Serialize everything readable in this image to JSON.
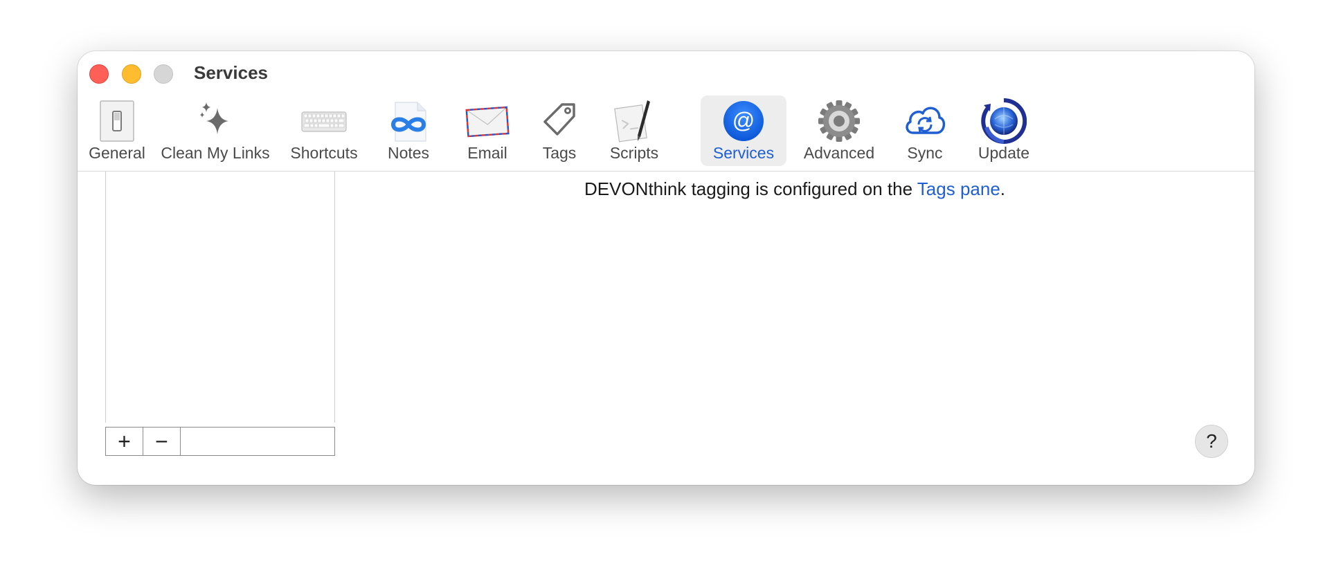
{
  "window": {
    "title": "Services"
  },
  "toolbar": {
    "items": [
      {
        "label": "General",
        "icon": "light-switch-icon"
      },
      {
        "label": "Clean My Links",
        "icon": "sparkles-icon"
      },
      {
        "label": "Shortcuts",
        "icon": "keyboard-icon"
      },
      {
        "label": "Notes",
        "icon": "infinity-icon"
      },
      {
        "label": "Email",
        "icon": "envelope-icon"
      },
      {
        "label": "Tags",
        "icon": "tag-icon"
      },
      {
        "label": "Scripts",
        "icon": "script-pen-icon"
      },
      {
        "label": "Services",
        "icon": "at-sign-icon",
        "selected": true
      },
      {
        "label": "Advanced",
        "icon": "gear-icon"
      },
      {
        "label": "Sync",
        "icon": "cloud-sync-icon"
      },
      {
        "label": "Update",
        "icon": "globe-refresh-icon"
      }
    ]
  },
  "list_footer": {
    "add": "+",
    "remove": "−"
  },
  "main": {
    "message_prefix": "DEVONthink tagging is configured on the ",
    "message_link": "Tags pane",
    "message_suffix": "."
  },
  "help": {
    "label": "?"
  },
  "colors": {
    "accent": "#1f5fd1",
    "close": "#fe5f57",
    "minimize": "#febc2e",
    "zoom": "#d6d6d6"
  }
}
